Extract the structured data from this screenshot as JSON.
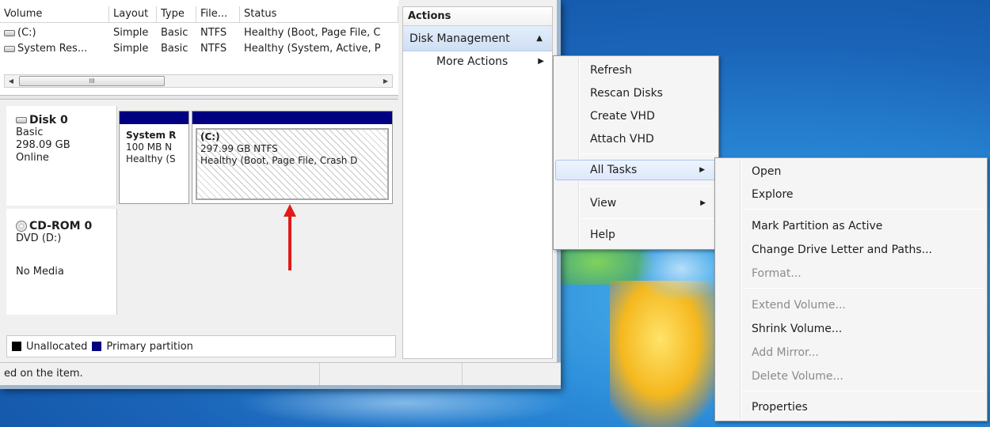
{
  "volume_list": {
    "headers": [
      "Volume",
      "Layout",
      "Type",
      "File...",
      "Status"
    ],
    "rows": [
      [
        "(C:)",
        "Simple",
        "Basic",
        "NTFS",
        "Healthy (Boot, Page File, C"
      ],
      [
        "System Res...",
        "Simple",
        "Basic",
        "NTFS",
        "Healthy (System, Active, P"
      ]
    ],
    "scroll_thumb": "III"
  },
  "disks": {
    "disk0": {
      "title": "Disk 0",
      "type": "Basic",
      "size": "298.09 GB",
      "state": "Online",
      "partitions": [
        {
          "name": "System R",
          "detail": "100 MB N",
          "status": "Healthy (S"
        },
        {
          "name": "(C:)",
          "detail": "297.99 GB NTFS",
          "status": "Healthy (Boot, Page File, Crash D"
        }
      ]
    },
    "cdrom0": {
      "title": "CD-ROM 0",
      "drive": "DVD (D:)",
      "media": "No Media"
    }
  },
  "legend": {
    "unallocated": "Unallocated",
    "primary": "Primary partition",
    "unallocated_color": "#000000",
    "primary_color": "#000080"
  },
  "statusbar": {
    "text": "ed on the item."
  },
  "actions": {
    "title": "Actions",
    "group": "Disk Management",
    "more_actions": "More Actions"
  },
  "more_actions_menu": {
    "items": [
      "Refresh",
      "Rescan Disks",
      "Create VHD",
      "Attach VHD",
      "All Tasks",
      "View",
      "Help"
    ]
  },
  "all_tasks_menu": {
    "items": [
      "Open",
      "Explore",
      "Mark Partition as Active",
      "Change Drive Letter and Paths...",
      "Format...",
      "Extend Volume...",
      "Shrink Volume...",
      "Add Mirror...",
      "Delete Volume...",
      "Properties"
    ],
    "disabled": [
      "Format...",
      "Extend Volume...",
      "Add Mirror...",
      "Delete Volume..."
    ]
  },
  "colors": {
    "partition_header": "#000080",
    "annotation_arrow": "#e01b1b",
    "menu_highlight": "#dce9fa"
  },
  "icons": {
    "drive": "drive-icon",
    "cdrom": "cdrom-icon",
    "submenu": "submenu-arrow-icon",
    "collapse": "collapse-triangle-icon"
  }
}
